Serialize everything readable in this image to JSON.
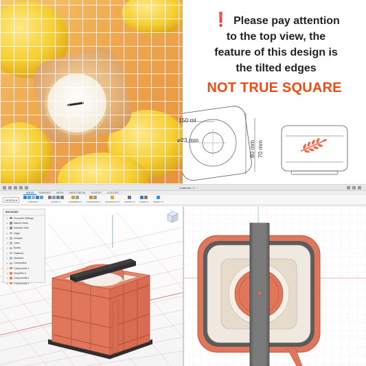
{
  "headline": {
    "mark": "❗",
    "lines": [
      "Please pay attention",
      "to the top view, the",
      "feature of this design is",
      "the tilted edges"
    ],
    "emphasis": "NOT TRUE SQUARE",
    "emphasis_color": "#f04a14"
  },
  "dimensions": {
    "volume": "150 ml",
    "wick_diameter": "⌀23 mm",
    "outer_height": "80 mm",
    "inner_height": "70 mm"
  },
  "photo": {
    "icons": [
      "lemon-icon",
      "candle-icon"
    ]
  },
  "cad": {
    "document_title": "Cuadrado / 1 ...",
    "tabs": [
      "SOLID",
      "SURFACE",
      "MESH",
      "SHEET METAL",
      "PLASTIC",
      "UTILITIES"
    ],
    "active_tab": "SOLID",
    "workspace_button": "DESIGN ▾",
    "toolbar_groups": [
      {
        "label": "CREATE ▾",
        "icon_colors": [
          "#3b82c4",
          "#4da3e0",
          "#8fb8d8",
          "#3b82c4",
          "#5aa0d2"
        ]
      },
      {
        "label": "MODIFY ▾",
        "icon_colors": [
          "#7a7a7a",
          "#9a9a9a",
          "#5f8fb8",
          "#7a7a7a"
        ]
      },
      {
        "label": "ASSEMBLE ▾",
        "icon_colors": [
          "#c4a23b",
          "#9a9a9a"
        ]
      },
      {
        "label": "CONFIGURE ▾",
        "icon_colors": [
          "#d48a2c",
          "#9a9a9a"
        ]
      },
      {
        "label": "CONSTRUCT ▾",
        "icon_colors": [
          "#e5a12c"
        ]
      },
      {
        "label": "INSPECT ▾",
        "icon_colors": [
          "#6d6d6d"
        ]
      },
      {
        "label": "INSERT ▾",
        "icon_colors": [
          "#3e7ab8",
          "#7a7a7a"
        ]
      },
      {
        "label": "SELECT ▾",
        "icon_colors": [
          "#3a8fd6"
        ]
      }
    ],
    "browser": {
      "header": "BROWSER",
      "nodes": [
        {
          "label": "Document Settings",
          "icon_color": "#8c8c8c"
        },
        {
          "label": "Named Views",
          "icon_color": "#8c8c8c"
        },
        {
          "label": "Selection Sets",
          "icon_color": "#8c8c8c"
        },
        {
          "label": "Origin",
          "icon_color": "#b8b8b8"
        },
        {
          "label": "Analysis",
          "icon_color": "#b8b8b8"
        },
        {
          "label": "Joints",
          "icon_color": "#b8b8b8"
        },
        {
          "label": "Bodies",
          "icon_color": "#b8b8b8"
        },
        {
          "label": "Flattened",
          "icon_color": "#b8b8b8"
        },
        {
          "label": "Sketches",
          "icon_color": "#b8b8b8"
        },
        {
          "label": "Construction",
          "icon_color": "#b8b8b8"
        },
        {
          "label": "Component1:1",
          "icon_color": "#e0885a"
        },
        {
          "label": "ShapeBox:1",
          "icon_color": "#e0885a"
        },
        {
          "label": "Component5:1",
          "icon_color": "#e0885a"
        },
        {
          "label": "Component3:1",
          "icon_color": "#e0885a"
        }
      ]
    },
    "colors": {
      "mold": "#e0765a",
      "mold_dark": "#b9553f",
      "bar": "#4a4a4a",
      "floor_line": "#d58080"
    }
  }
}
